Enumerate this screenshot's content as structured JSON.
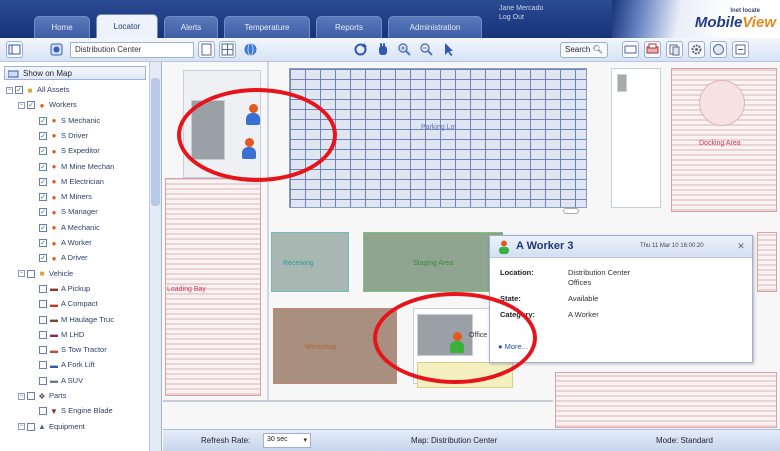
{
  "tabs": [
    {
      "label": "Home"
    },
    {
      "label": "Locator"
    },
    {
      "label": "Alerts"
    },
    {
      "label": "Temperature"
    },
    {
      "label": "Reports"
    },
    {
      "label": "Administration"
    }
  ],
  "user_info": {
    "line1": "Jane Mercado",
    "line2": "Log Out"
  },
  "logo": {
    "small": "Inet locate",
    "main": "Mobile",
    "main_accent": "View"
  },
  "toolbar": {
    "location_value": "Distribution Center",
    "search_label": "Search",
    "accent": "#2f57b5"
  },
  "sidebar": {
    "header": "Show on Map",
    "items": [
      {
        "label": "All Assets",
        "icon": "folder-icon",
        "checked": true
      },
      {
        "label": "Workers",
        "icon": "worker-icon",
        "checked": true
      },
      {
        "label": "S Mechanic",
        "icon": "worker-icon",
        "checked": true
      },
      {
        "label": "S Driver",
        "icon": "worker-icon",
        "checked": true
      },
      {
        "label": "S Expeditor",
        "icon": "worker-icon",
        "checked": true
      },
      {
        "label": "M Mine Mechan",
        "icon": "worker-icon",
        "checked": true
      },
      {
        "label": "M Electrician",
        "icon": "worker-icon",
        "checked": true
      },
      {
        "label": "M Miners",
        "icon": "worker-icon",
        "checked": true
      },
      {
        "label": "S Manager",
        "icon": "worker-icon",
        "checked": true
      },
      {
        "label": "A Mechanic",
        "icon": "worker-icon",
        "checked": true
      },
      {
        "label": "A Worker",
        "icon": "worker-icon",
        "checked": true
      },
      {
        "label": "A Driver",
        "icon": "worker-icon",
        "checked": true
      },
      {
        "label": "Vehicle",
        "icon": "vehicle-icon",
        "checked": false
      },
      {
        "label": "A Pickup",
        "icon": "pickup-icon",
        "checked": false
      },
      {
        "label": "A Compact",
        "icon": "compact-car-icon",
        "checked": false
      },
      {
        "label": "M Haulage Truc",
        "icon": "truck-icon",
        "checked": false
      },
      {
        "label": "M LHD",
        "icon": "loader-icon",
        "checked": false
      },
      {
        "label": "S Tow Tractor",
        "icon": "tractor-icon",
        "checked": false
      },
      {
        "label": "A Fork Lift",
        "icon": "forklift-icon",
        "checked": false
      },
      {
        "label": "A SUV",
        "icon": "suv-icon",
        "checked": false
      },
      {
        "label": "Parts",
        "icon": "parts-icon",
        "checked": false
      },
      {
        "label": "S Engine Blade",
        "icon": "blade-icon",
        "checked": false
      },
      {
        "label": "Equipment",
        "icon": "equipment-icon",
        "checked": false
      }
    ]
  },
  "map": {
    "zones": [
      {
        "label": "Parking Lot",
        "color": "#6070b0"
      },
      {
        "label": "Docking Area",
        "color": "#d23a5a"
      },
      {
        "label": "Loading Bay",
        "color": "#d23a5a"
      },
      {
        "label": "Receiving",
        "color": "#2a9a9a"
      },
      {
        "label": "Staging Area",
        "color": "#3c8a3c"
      },
      {
        "label": "Workshop",
        "color": "#b2642c"
      },
      {
        "label": "Office",
        "color": "#334"
      }
    ]
  },
  "popup": {
    "title": "A Worker 3",
    "time": "Thu 11 Mar 10 16:00:20",
    "fields": [
      {
        "label": "Location:",
        "value": "Distribution Center|Offices"
      },
      {
        "label": "State:",
        "value": "Available"
      },
      {
        "label": "Category:",
        "value": "A Worker"
      }
    ],
    "link": "More..."
  },
  "status": {
    "refresh_label": "Refresh Rate:",
    "refresh_value": "30 sec",
    "map_label": "Map:",
    "map_value": "Distribution Center",
    "mode_label": "Mode:",
    "mode_value": "Standard"
  }
}
